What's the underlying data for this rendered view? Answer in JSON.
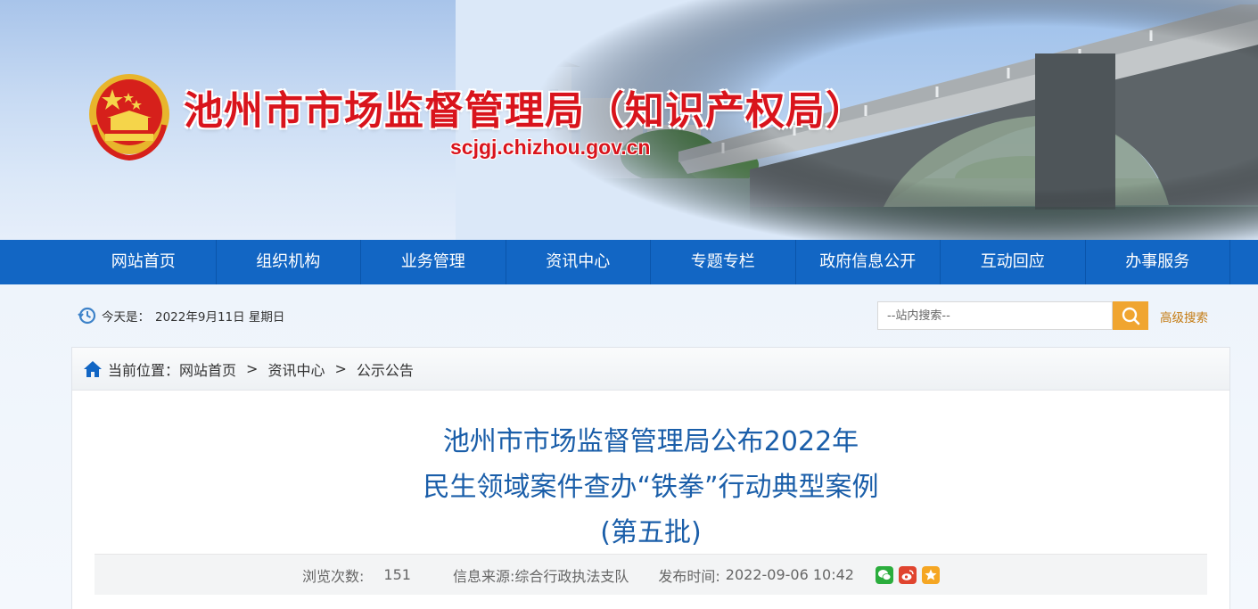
{
  "header": {
    "site_title": "池州市市场监督管理局（知识产权局）",
    "site_url": "scjgj.chizhou.gov.cn",
    "emblem_icon": "national-emblem-icon"
  },
  "nav": {
    "items": [
      {
        "label": "网站首页"
      },
      {
        "label": "组织机构"
      },
      {
        "label": "业务管理"
      },
      {
        "label": "资讯中心"
      },
      {
        "label": "专题专栏"
      },
      {
        "label": "政府信息公开"
      },
      {
        "label": "互动回应"
      },
      {
        "label": "办事服务"
      }
    ]
  },
  "toolbar": {
    "today_label": "今天是：",
    "today_value": "2022年9月11日 星期日",
    "search_placeholder": "--站内搜索--",
    "advanced_search": "高级搜索"
  },
  "breadcrumb": {
    "prefix": "当前位置：",
    "items": [
      "网站首页",
      "资讯中心",
      "公示公告"
    ],
    "separator": ">"
  },
  "article": {
    "title_lines": [
      "池州市市场监督管理局公布2022年",
      "民生领域案件查办“铁拳”行动典型案例",
      "(第五批)"
    ],
    "meta": {
      "views_label": "浏览次数:",
      "views_count": "151",
      "source_label": "信息来源:",
      "source_value": "综合行政执法支队",
      "time_label": "发布时间:",
      "time_value": "2022-09-06 10:42"
    },
    "share_icons": [
      "wechat-icon",
      "weibo-icon",
      "favorite-star-icon"
    ]
  },
  "colors": {
    "nav_bg": "#1266c4",
    "title_red": "#d9141c",
    "article_title": "#1a5ea9",
    "search_button": "#f0a530",
    "wechat": "#2bad3d",
    "weibo": "#e0442f",
    "favorite": "#f5a623"
  }
}
